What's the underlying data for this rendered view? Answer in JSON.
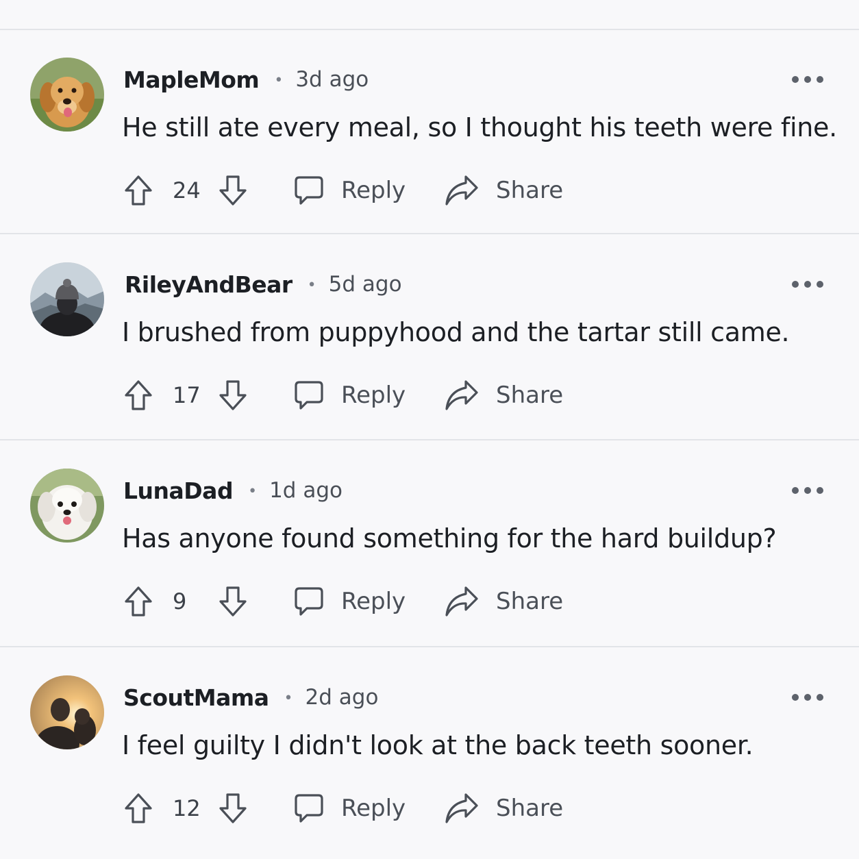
{
  "comments": [
    {
      "username": "MapleMom",
      "separator": "•",
      "time": "3d ago",
      "text": "He still ate every meal, so I thought his teeth were fine.",
      "score": "24",
      "reply_label": "Reply",
      "share_label": "Share",
      "avatar": "golden-retriever-avatar"
    },
    {
      "username": "RileyAndBear",
      "separator": "•",
      "time": "5d ago",
      "text": "I brushed from puppyhood and the tartar still came.",
      "score": "17",
      "reply_label": "Reply",
      "share_label": "Share",
      "avatar": "person-beanie-mountains-avatar"
    },
    {
      "username": "LunaDad",
      "separator": "•",
      "time": "1d ago",
      "text": "Has anyone found something for the hard buildup?",
      "score": "9",
      "reply_label": "Reply",
      "share_label": "Share",
      "avatar": "white-fluffy-dog-avatar"
    },
    {
      "username": "ScoutMama",
      "separator": "•",
      "time": "2d ago",
      "text": "I feel guilty I didn't look at the back teeth sooner.",
      "score": "12",
      "reply_label": "Reply",
      "share_label": "Share",
      "avatar": "person-with-dog-sunset-avatar"
    }
  ],
  "icons": {
    "upvote": "upvote-arrow-icon",
    "downvote": "downvote-arrow-icon",
    "reply": "speech-bubble-icon",
    "share": "share-arrow-icon",
    "more": "more-options-icon"
  },
  "colors": {
    "background": "#f8f8fa",
    "divider": "#e2e4e8",
    "text": "#1c1f24",
    "muted": "#4a4f57"
  }
}
